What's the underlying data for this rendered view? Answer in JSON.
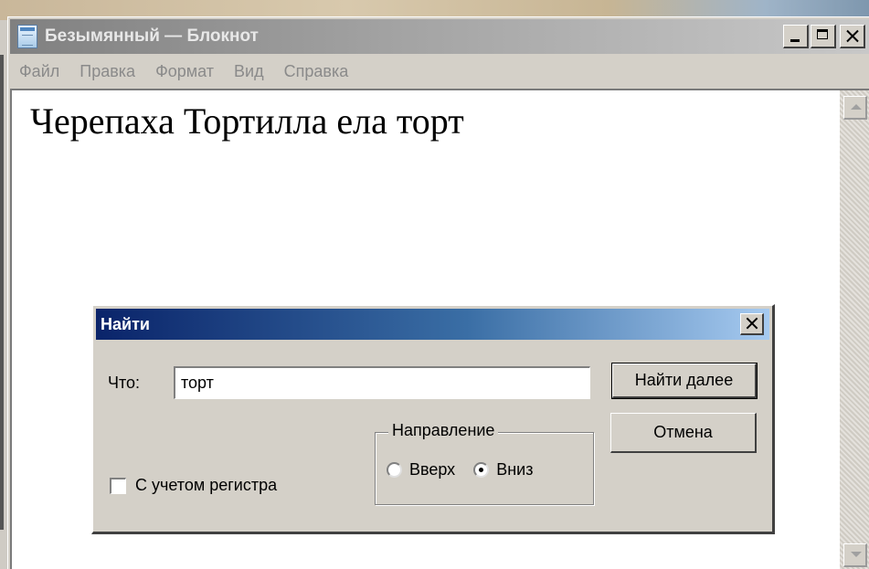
{
  "window": {
    "title": "Безымянный — Блокнот",
    "icon": "notepad-icon"
  },
  "menu": {
    "items": [
      "Файл",
      "Правка",
      "Формат",
      "Вид",
      "Справка"
    ]
  },
  "editor": {
    "content": "Черепаха Тортилла ела торт"
  },
  "find_dialog": {
    "title": "Найти",
    "what_label": "Что:",
    "what_value": "торт",
    "find_next_label": "Найти далее",
    "cancel_label": "Отмена",
    "direction_label": "Направление",
    "up_label": "Вверх",
    "down_label": "Вниз",
    "direction_selected": "Вниз",
    "match_case_label": "С учетом регистра",
    "match_case_checked": false
  },
  "colors": {
    "dialog_title_start": "#0a246a",
    "dialog_title_end": "#a6caf0",
    "window_face": "#d4d0c8",
    "inactive_title": "#808080"
  }
}
